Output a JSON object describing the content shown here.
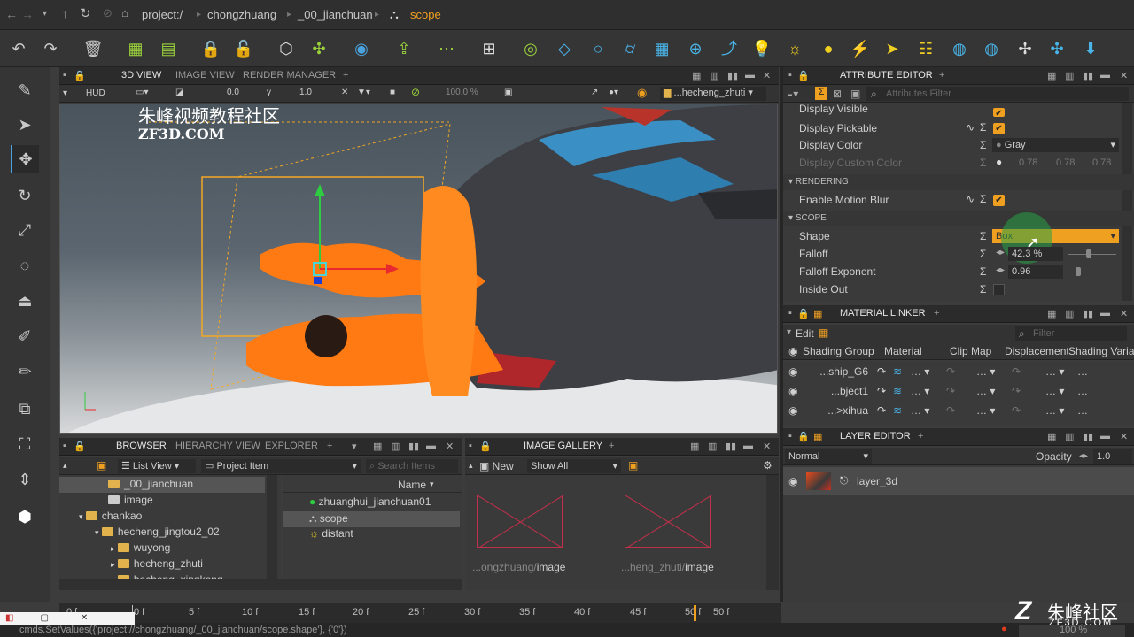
{
  "breadcrumb": {
    "project": "project:/",
    "p1": "chongzhuang",
    "p2": "_00_jianchuan",
    "current": "scope"
  },
  "viewport_panel": {
    "tabs": [
      "3D VIEW",
      "IMAGE VIEW",
      "RENDER MANAGER"
    ],
    "hud": "HUD",
    "exposure": "0.0",
    "gamma": "1.0",
    "zoom": "100.0 %",
    "scene_select": "...hecheng_zhuti",
    "watermark_cn": "朱峰视频教程社区",
    "watermark_en": "ZF3D.COM"
  },
  "attribute_editor": {
    "title": "ATTRIBUTE EDITOR",
    "filter_placeholder": "Attributes Filter",
    "cut_row": "Display Visible",
    "display_pickable": "Display Pickable",
    "display_color": "Display Color",
    "display_color_value": "Gray",
    "display_custom_color": "Display Custom Color",
    "cc_r": "0.78",
    "cc_g": "0.78",
    "cc_b": "0.78",
    "sec_rendering": "RENDERING",
    "enable_motion_blur": "Enable Motion Blur",
    "sec_scope": "SCOPE",
    "shape": "Shape",
    "shape_value": "Box",
    "falloff": "Falloff",
    "falloff_value": "42.3 %",
    "falloff_exponent": "Falloff Exponent",
    "falloff_exponent_value": "0.96",
    "inside_out": "Inside Out"
  },
  "material_linker": {
    "title": "MATERIAL LINKER",
    "edit": "Edit",
    "filter": "Filter",
    "columns": [
      "Shading Group",
      "Material",
      "Clip Map",
      "Displacement",
      "Shading Variable"
    ],
    "rows": [
      "...ship_G6",
      "...bject1",
      "...>xihua"
    ]
  },
  "layer_editor": {
    "title": "LAYER EDITOR",
    "blend": "Normal",
    "opacity_label": "Opacity",
    "opacity_value": "1.0",
    "layer": "layer_3d"
  },
  "browser": {
    "tabs": [
      "BROWSER",
      "HIERARCHY VIEW",
      "EXPLORER"
    ],
    "list_view": "List View",
    "project_item": "Project Item",
    "search": "Search Items",
    "tree": [
      "_00_jianchuan",
      "image",
      "chankao",
      "hecheng_jingtou2_02",
      "wuyong",
      "hecheng_zhuti",
      "hecheng_xingkong"
    ],
    "name_col": "Name",
    "items": [
      "zhuanghui_jianchuan01",
      "scope",
      "distant"
    ]
  },
  "image_gallery": {
    "title": "IMAGE GALLERY",
    "new": "New",
    "show": "Show All",
    "thumb1_path": "...ongzhuang/",
    "thumb1_name": "image",
    "thumb2_path": "...heng_zhuti/",
    "thumb2_name": "image"
  },
  "timeline": {
    "ticks": [
      "0 f",
      "0 f",
      "5 f",
      "10 f",
      "15 f",
      "20 f",
      "25 f",
      "30 f",
      "35 f",
      "40 f",
      "45 f",
      "50 f",
      "50 f"
    ]
  },
  "status": {
    "command": "cmds.SetValues({'project://chongzhuang/_00_jianchuan/scope.shape'}, {'0'})",
    "zoom": "100 %"
  },
  "corner_logo": {
    "cn": "朱峰社区",
    "en": "ZF3D.COM"
  },
  "colors": {
    "accent_orange": "#f0a020",
    "selection_blue": "#4aa3df"
  }
}
